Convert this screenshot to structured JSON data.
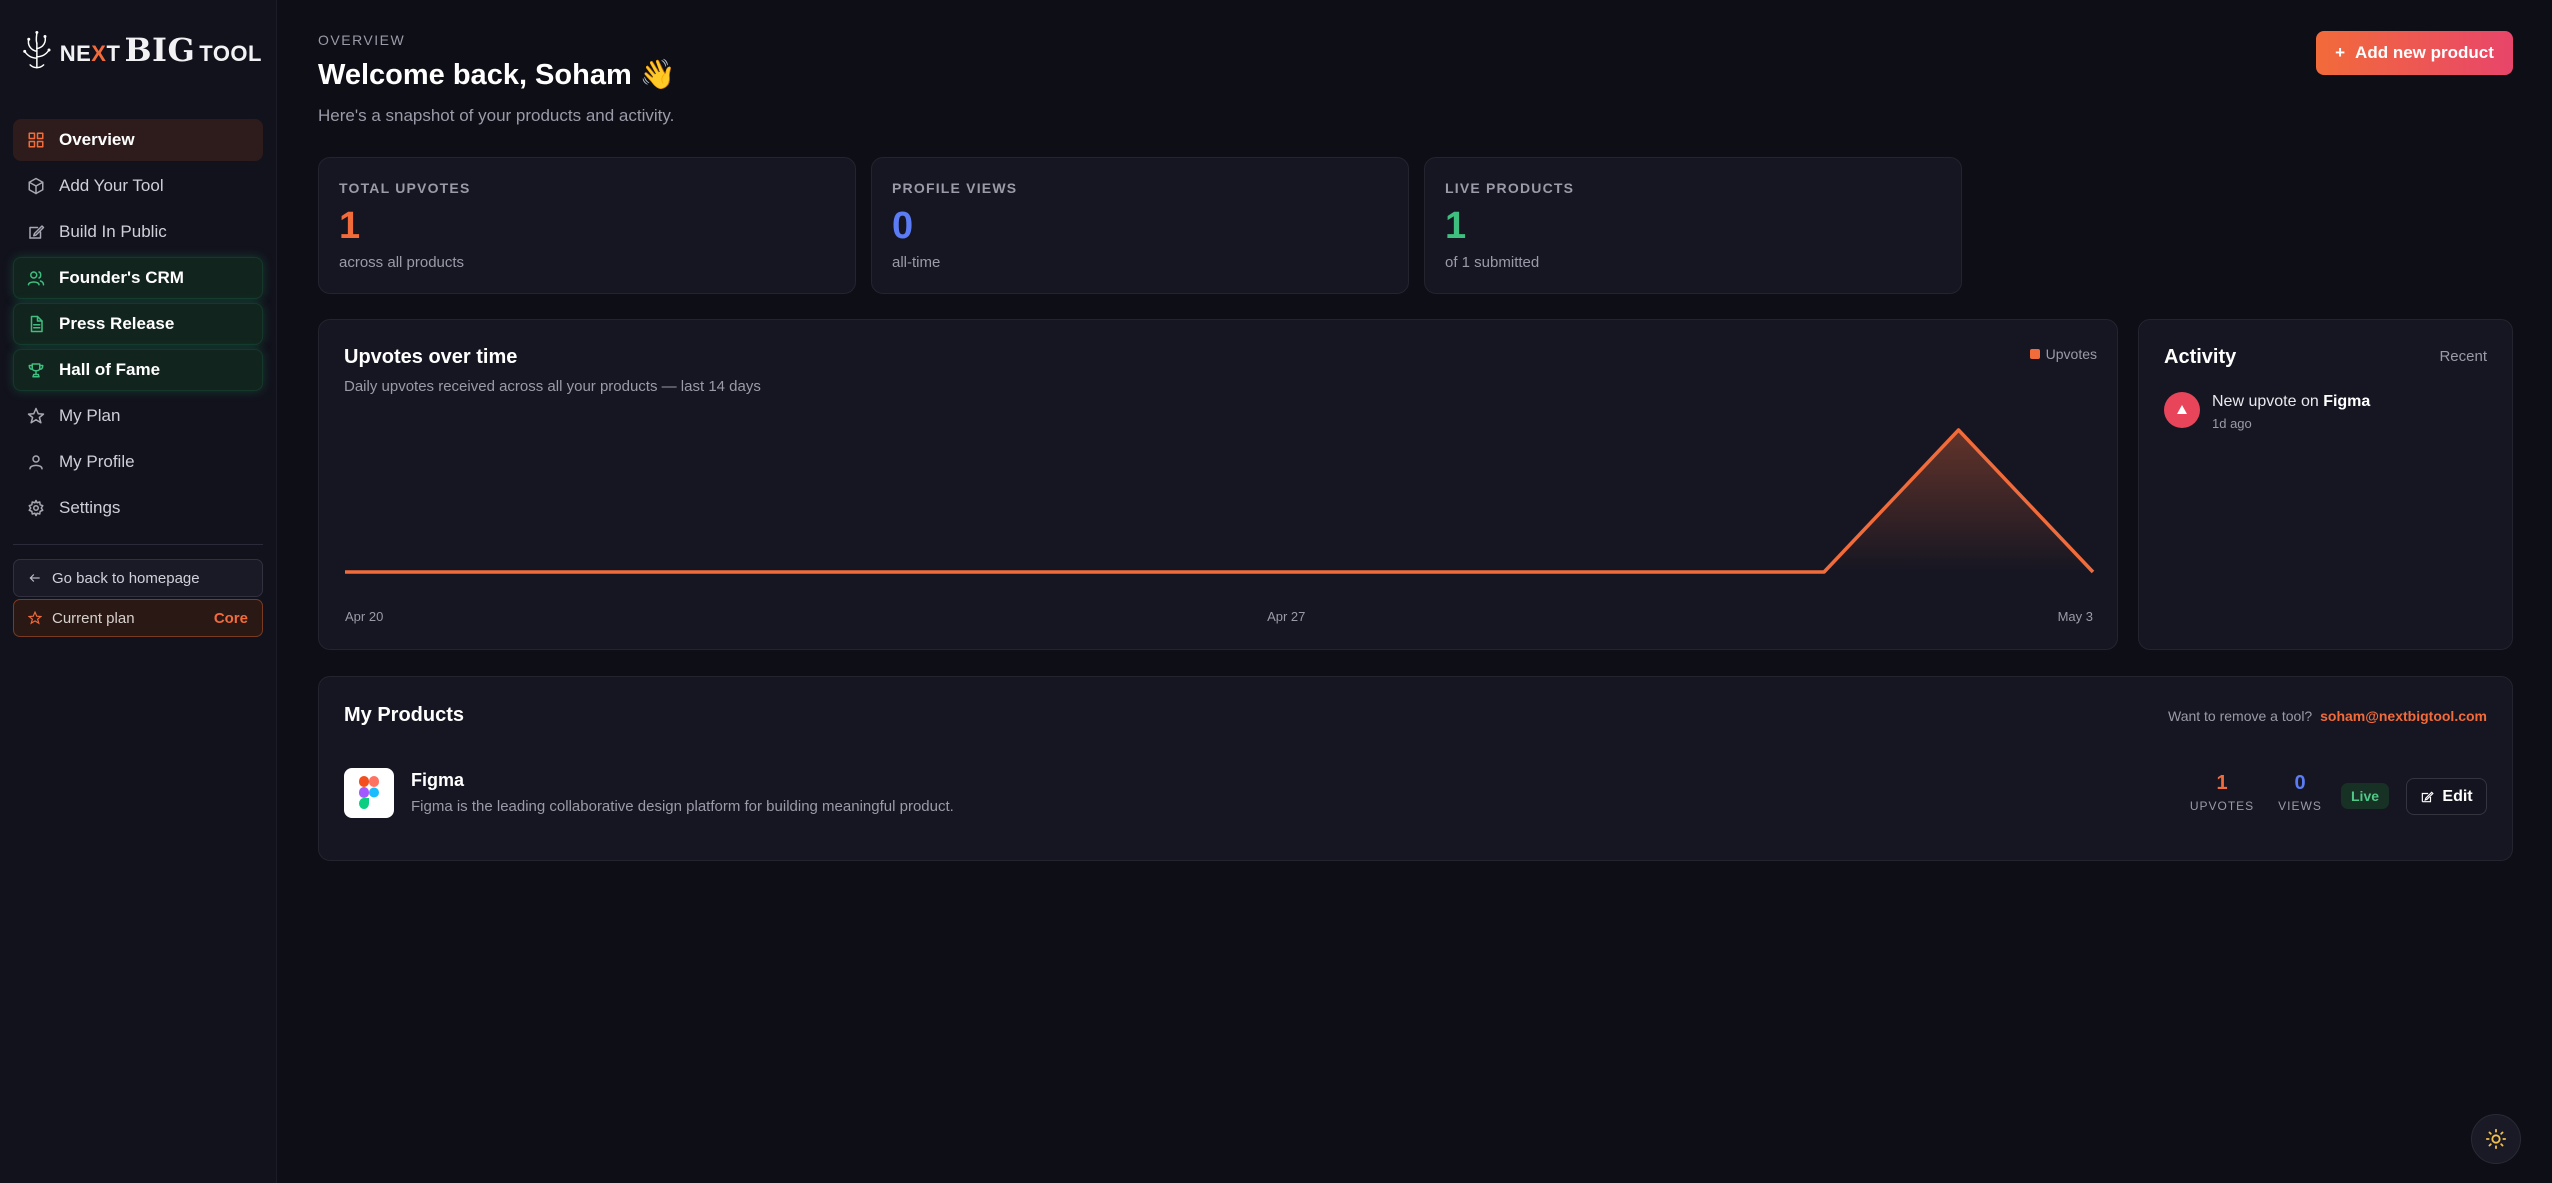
{
  "brand": {
    "part1": "NE",
    "part1_x": "X",
    "part1_t": "T",
    "part2": "BIG",
    "part3": "TOOL"
  },
  "sidebar": {
    "items": [
      {
        "label": "Overview",
        "icon": "grid-icon",
        "state": "active"
      },
      {
        "label": "Add Your Tool",
        "icon": "box-icon",
        "state": "normal"
      },
      {
        "label": "Build In Public",
        "icon": "edit-icon",
        "state": "normal"
      },
      {
        "label": "Founder's CRM",
        "icon": "users-icon",
        "state": "highlight"
      },
      {
        "label": "Press Release",
        "icon": "document-icon",
        "state": "highlight"
      },
      {
        "label": "Hall of Fame",
        "icon": "trophy-icon",
        "state": "highlight"
      },
      {
        "label": "My Plan",
        "icon": "star-icon",
        "state": "normal"
      },
      {
        "label": "My Profile",
        "icon": "user-icon",
        "state": "normal"
      },
      {
        "label": "Settings",
        "icon": "gear-icon",
        "state": "normal"
      }
    ],
    "back_label": "Go back to homepage",
    "plan_label": "Current plan",
    "plan_value": "Core"
  },
  "header": {
    "eyebrow": "OVERVIEW",
    "title": "Welcome back, Soham 👋",
    "subtitle": "Here's a snapshot of your products and activity.",
    "add_button": "Add new product",
    "add_button_icon": "+"
  },
  "stats": [
    {
      "label": "TOTAL UPVOTES",
      "value": "1",
      "sub": "across all products",
      "color": "#f26b3a"
    },
    {
      "label": "PROFILE VIEWS",
      "value": "0",
      "sub": "all-time",
      "color": "#5b7cf5"
    },
    {
      "label": "LIVE PRODUCTS",
      "value": "1",
      "sub": "of 1 submitted",
      "color": "#3fbf7f"
    }
  ],
  "chart_data": {
    "type": "area",
    "title": "Upvotes over time",
    "subtitle": "Daily upvotes received across all your products — last 14 days",
    "legend": "Upvotes",
    "legend_position": "top-right",
    "x_ticks": [
      "Apr 20",
      "Apr 27",
      "May 3"
    ],
    "series": [
      {
        "name": "Upvotes",
        "values": [
          0,
          0,
          0,
          0,
          0,
          0,
          0,
          0,
          0,
          0,
          0,
          0,
          1,
          0
        ]
      }
    ],
    "ylim": [
      0,
      1
    ],
    "grid": false,
    "color": "#f26b3a"
  },
  "activity": {
    "title": "Activity",
    "recent": "Recent",
    "items": [
      {
        "text": "New upvote on",
        "target": "Figma",
        "time": "1d ago"
      }
    ]
  },
  "products": {
    "title": "My Products",
    "remove_text": "Want to remove a tool?",
    "remove_email": "soham@nextbigtool.com",
    "items": [
      {
        "name": "Figma",
        "description": "Figma is the leading collaborative design platform for building meaningful product.",
        "upvotes": "1",
        "upvotes_label": "UPVOTES",
        "views": "0",
        "views_label": "VIEWS",
        "status": "Live",
        "edit_label": "Edit"
      }
    ]
  }
}
